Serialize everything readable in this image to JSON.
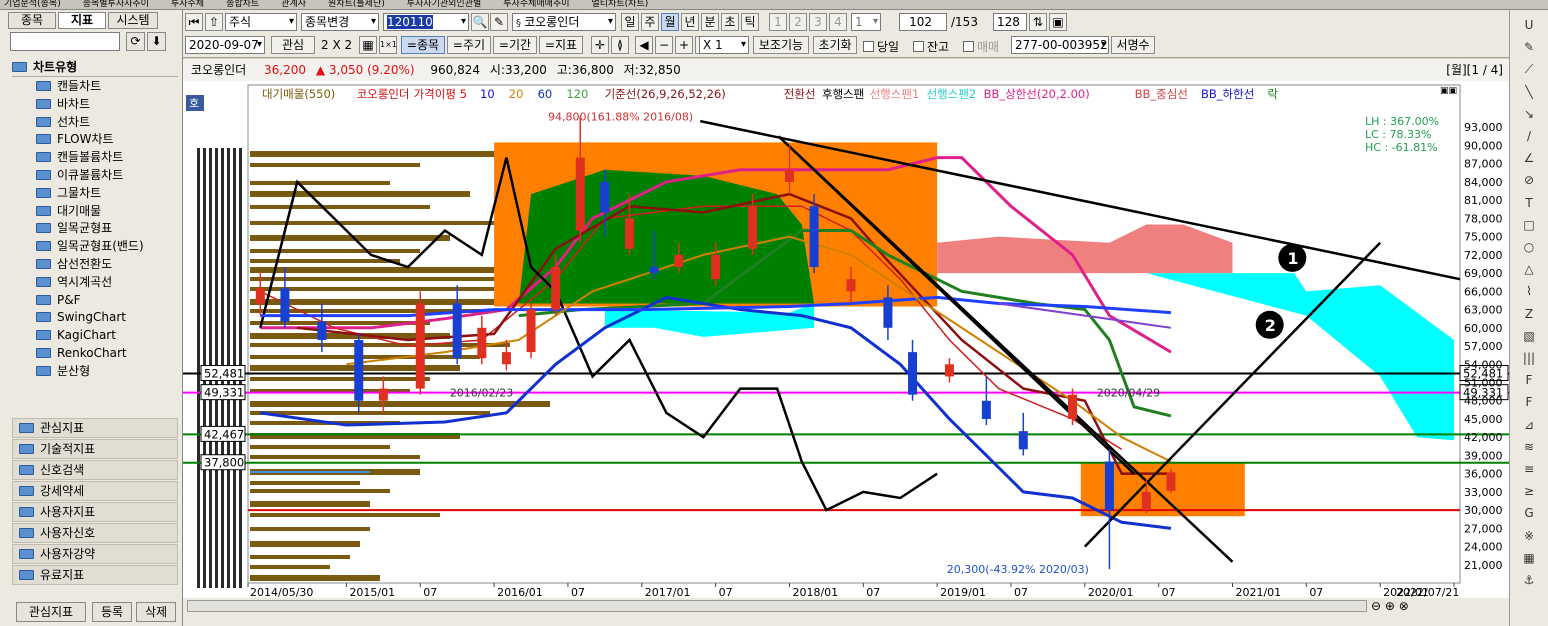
{
  "top_strip": [
    "기업분석(종목)",
    "종목별투자자추이",
    "투자주체",
    "종합차트",
    "관계사",
    "원차트(틀제단)",
    "투자자기관외인관별",
    "투자주체매매추이",
    "멀티차트(차트)"
  ],
  "left_panel": {
    "tabs": [
      "종목",
      "지표",
      "시스템"
    ],
    "chart_type_header": "차트유형",
    "tree_items": [
      "캔들차트",
      "바차트",
      "선차트",
      "FLOW차트",
      "캔들볼륨차트",
      "이큐볼륨차트",
      "그물차트",
      "대기매물",
      "일목균형표",
      "일목균형표(밴드)",
      "삼선전환도",
      "역시계곡선",
      "P&F",
      "SwingChart",
      "KagiChart",
      "RenkoChart",
      "분산형"
    ],
    "groups": [
      "관심지표",
      "기술적지표",
      "신호검색",
      "강세약세",
      "사용자지표",
      "사용자신호",
      "사용자강약",
      "유료지표"
    ],
    "bottom_tabs": [
      "관심지표",
      "등록",
      "삭제"
    ]
  },
  "toolbar1": {
    "market": "주식",
    "change_label": "종목변경",
    "code": "120110",
    "stock_name": "코오롱인더",
    "periods": [
      "일",
      "주",
      "월",
      "년",
      "분",
      "초",
      "틱"
    ],
    "selected_period": "월",
    "nums": [
      "1",
      "2",
      "3",
      "4"
    ],
    "num_select": "1",
    "count": "102",
    "total": "/153",
    "display_count": "128"
  },
  "toolbar2": {
    "date": "2020-09-07",
    "interest": "관심",
    "grid": "2 X 2",
    "one_by_one": "1×1",
    "toggle_buttons": [
      "=종목",
      "=주기",
      "=기간",
      "=지표"
    ],
    "selected_toggle": "=종목",
    "multiplier": "X 1",
    "aux_button": "보조기능",
    "init_button": "초기화",
    "checkboxes": [
      "당일",
      "잔고",
      "매매"
    ],
    "account": "277-00-003952",
    "sign_button": "서명수"
  },
  "info_bar": {
    "name": "코오롱인더",
    "price": "36,200",
    "change": "▲ 3,050",
    "pct": "(9.20%)",
    "volume": "960,824",
    "open": "시:33,200",
    "high": "고:36,800",
    "low": "저:32,850",
    "page": "[월][1 / 4]"
  },
  "legend": [
    {
      "text": "대기매물(550)",
      "color": "#7a5a10"
    },
    {
      "text": "코오롱인더",
      "color": "#d01010"
    },
    {
      "text": "가격이평 5",
      "color": "#d01010"
    },
    {
      "text": "10",
      "color": "#1010d0"
    },
    {
      "text": "20",
      "color": "#d08000"
    },
    {
      "text": "60",
      "color": "#1030c0"
    },
    {
      "text": "120",
      "color": "#40a040"
    },
    {
      "text": "기준선(26,9,26,52,26)",
      "color": "#8b1010"
    },
    {
      "text": "전환선",
      "color": "#8b1010"
    },
    {
      "text": "후행스팬",
      "color": "#000"
    },
    {
      "text": "선행스팬1",
      "color": "#f08080"
    },
    {
      "text": "선행스팬2",
      "color": "#20d0d0"
    },
    {
      "text": "BB_상한선(20,2.00)",
      "color": "#e0208a"
    },
    {
      "text": "BB_중심선",
      "color": "#d04040"
    },
    {
      "text": "BB_하한선",
      "color": "#1010d0"
    },
    {
      "text": "락",
      "color": "#208020"
    }
  ],
  "stats": {
    "lh": "LH :  367.00%",
    "lc": "LC :   78.33%",
    "hc": "HC :  -61.81%"
  },
  "annotations": {
    "high": "94,800(161.88% 2016/08)",
    "low": "20,300(-43.92% 2020/03)",
    "mark1": "2016/02/23",
    "mark2": "2020/04/29"
  },
  "hlines": [
    {
      "label": "52,481",
      "color": "#000000",
      "value": 52481
    },
    {
      "label": "49,331",
      "color": "#ff00ff",
      "value": 49331
    },
    {
      "label": "42,467",
      "color": "#008000",
      "value": 42467
    },
    {
      "label": "37,800",
      "color": "#008000",
      "value": 37800
    }
  ],
  "y_axis": [
    "93,000",
    "90,000",
    "87,000",
    "84,000",
    "81,000",
    "78,000",
    "75,000",
    "72,000",
    "69,000",
    "66,000",
    "63,000",
    "60,000",
    "57,000",
    "54,000",
    "51,000",
    "48,000",
    "45,000",
    "42,000",
    "39,000",
    "36,000",
    "33,000",
    "30,000",
    "27,000",
    "24,000",
    "21,000"
  ],
  "x_axis": [
    "2014/05/30",
    "2015/01",
    "07",
    "2016/01",
    "07",
    "2017/01",
    "07",
    "2018/01",
    "07",
    "2019/01",
    "07",
    "2020/01",
    "07",
    "2021/01",
    "07",
    "2022/01",
    "2022/07/21"
  ],
  "circle_labels": [
    "1",
    "2"
  ],
  "toggle_label": "호",
  "colors": {
    "up": "#e03020",
    "down": "#1840d0",
    "orange_box": "#ff8000",
    "green_fill": "#008000",
    "cyan_cloud": "#00ffff",
    "pink_cloud": "#f08080"
  },
  "chart_data": {
    "type": "candlestick",
    "series_name": "코오롱인더",
    "period": "월",
    "ylim": [
      19000,
      96000
    ],
    "x_range": [
      "2014/05",
      "2022/07"
    ],
    "ohlc": [
      [
        "2014/06",
        64000,
        69000,
        62000,
        66500
      ],
      [
        "2014/08",
        66500,
        70000,
        60000,
        61000
      ],
      [
        "2014/11",
        61000,
        64000,
        56000,
        58000
      ],
      [
        "2015/02",
        58000,
        59000,
        46000,
        48000
      ],
      [
        "2015/04",
        48000,
        52000,
        46000,
        50000
      ],
      [
        "2015/07",
        50000,
        66000,
        49000,
        64000
      ],
      [
        "2015/10",
        64000,
        67000,
        54000,
        55000
      ],
      [
        "2015/12",
        55000,
        62000,
        54000,
        60000
      ],
      [
        "2016/02",
        54000,
        58000,
        53000,
        56000
      ],
      [
        "2016/04",
        56000,
        64000,
        55000,
        63000
      ],
      [
        "2016/06",
        63000,
        72000,
        62000,
        70000
      ],
      [
        "2016/08",
        76000,
        94800,
        74000,
        88000
      ],
      [
        "2016/10",
        84000,
        86000,
        75000,
        79000
      ],
      [
        "2016/12",
        73000,
        82000,
        72000,
        78000
      ],
      [
        "2017/02",
        70000,
        76000,
        68000,
        69000
      ],
      [
        "2017/04",
        70000,
        74000,
        69000,
        72000
      ],
      [
        "2017/07",
        68000,
        74000,
        67000,
        72000
      ],
      [
        "2017/10",
        73000,
        82000,
        72000,
        80000
      ],
      [
        "2018/01",
        84000,
        90000,
        82000,
        86000
      ],
      [
        "2018/03",
        80000,
        82000,
        69000,
        70000
      ],
      [
        "2018/06",
        66000,
        70000,
        64000,
        68000
      ],
      [
        "2018/09",
        65000,
        67000,
        58000,
        60000
      ],
      [
        "2018/11",
        56000,
        58000,
        48000,
        49000
      ],
      [
        "2019/02",
        52000,
        55000,
        51000,
        54000
      ],
      [
        "2019/05",
        48000,
        52000,
        44000,
        45000
      ],
      [
        "2019/08",
        43000,
        46000,
        39000,
        40000
      ],
      [
        "2019/12",
        45000,
        50000,
        44000,
        49000
      ],
      [
        "2020/03",
        38000,
        40000,
        20300,
        30000
      ],
      [
        "2020/06",
        30000,
        35000,
        29500,
        33000
      ],
      [
        "2020/08",
        33200,
        36800,
        32850,
        36200
      ]
    ]
  }
}
